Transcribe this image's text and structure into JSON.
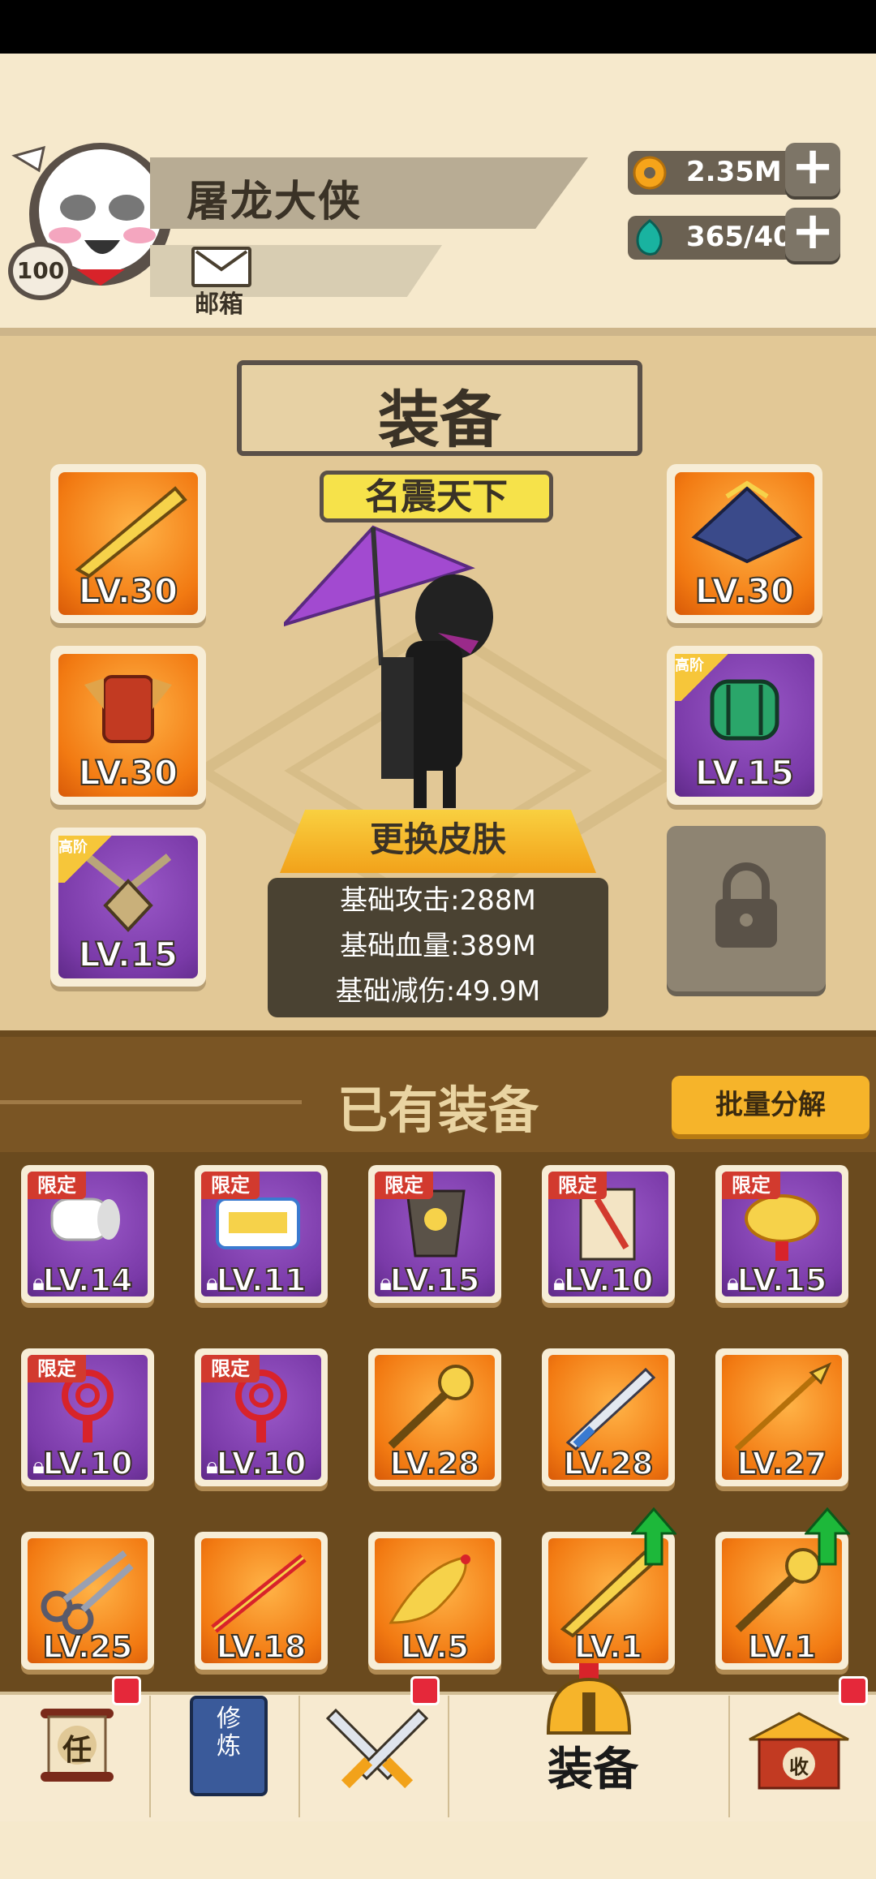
{
  "player": {
    "name": "屠龙大侠",
    "level": "100",
    "mail_label": "邮箱"
  },
  "resources": {
    "coins": "2.35M",
    "gems": "365/40",
    "plus": "+"
  },
  "panel": {
    "title": "装备",
    "rank_banner": "名震天下",
    "change_skin": "更换皮肤",
    "stats": [
      "基础攻击:288M",
      "基础血量:389M",
      "基础减伤:49.9M"
    ]
  },
  "slots_left": [
    {
      "icon": "golden-sword-icon",
      "level": "LV.30",
      "rarity": "orange",
      "tag": ""
    },
    {
      "icon": "red-armor-icon",
      "level": "LV.30",
      "rarity": "orange",
      "tag": ""
    },
    {
      "icon": "pendant-icon",
      "level": "LV.15",
      "rarity": "purple",
      "tag": "高阶"
    }
  ],
  "slots_right": [
    {
      "icon": "blue-hat-icon",
      "level": "LV.30",
      "rarity": "orange",
      "tag": ""
    },
    {
      "icon": "green-bracer-icon",
      "level": "LV.15",
      "rarity": "purple",
      "tag": "高阶"
    }
  ],
  "owned": {
    "title": "已有装备",
    "batch_button": "批量分解",
    "items": [
      {
        "icon": "toilet-roll-icon",
        "level": "LV.14",
        "rarity": "purple",
        "tag": "限定",
        "locked": true,
        "upgrade": false
      },
      {
        "icon": "snack-pack-icon",
        "level": "LV.11",
        "rarity": "purple",
        "tag": "限定",
        "locked": true,
        "upgrade": false
      },
      {
        "icon": "scroll-banner-icon",
        "level": "LV.15",
        "rarity": "purple",
        "tag": "限定",
        "locked": true,
        "upgrade": false
      },
      {
        "icon": "comic-book-icon",
        "level": "LV.10",
        "rarity": "purple",
        "tag": "限定",
        "locked": true,
        "upgrade": false
      },
      {
        "icon": "gold-ingot-icon",
        "level": "LV.15",
        "rarity": "purple",
        "tag": "限定",
        "locked": true,
        "upgrade": false
      },
      {
        "icon": "chinese-knot-icon",
        "level": "LV.10",
        "rarity": "purple",
        "tag": "限定",
        "locked": true,
        "upgrade": false
      },
      {
        "icon": "chinese-knot-icon",
        "level": "LV.10",
        "rarity": "purple",
        "tag": "限定",
        "locked": true,
        "upgrade": false
      },
      {
        "icon": "mace-icon",
        "level": "LV.28",
        "rarity": "orange",
        "tag": "",
        "locked": false,
        "upgrade": false
      },
      {
        "icon": "steel-sword-icon",
        "level": "LV.28",
        "rarity": "orange",
        "tag": "",
        "locked": false,
        "upgrade": false
      },
      {
        "icon": "spear-icon",
        "level": "LV.27",
        "rarity": "orange",
        "tag": "",
        "locked": false,
        "upgrade": false
      },
      {
        "icon": "scissors-icon",
        "level": "LV.25",
        "rarity": "orange",
        "tag": "",
        "locked": false,
        "upgrade": false
      },
      {
        "icon": "staff-icon",
        "level": "LV.18",
        "rarity": "orange",
        "tag": "",
        "locked": false,
        "upgrade": false
      },
      {
        "icon": "rubber-chicken-icon",
        "level": "LV.5",
        "rarity": "orange",
        "tag": "",
        "locked": false,
        "upgrade": false
      },
      {
        "icon": "golden-sword-icon",
        "level": "LV.1",
        "rarity": "orange",
        "tag": "",
        "locked": false,
        "upgrade": true
      },
      {
        "icon": "mace-icon",
        "level": "LV.1",
        "rarity": "orange",
        "tag": "",
        "locked": false,
        "upgrade": true
      }
    ]
  },
  "nav": {
    "tasks_glyph": "任",
    "cultivate_glyph": "修炼",
    "equip_label": "装备",
    "shop_glyph": "收"
  },
  "colors": {
    "orange": "#f27a12",
    "purple": "#7a3aa8",
    "badge_red": "#e5283a",
    "upgrade_green": "#1db83a"
  }
}
